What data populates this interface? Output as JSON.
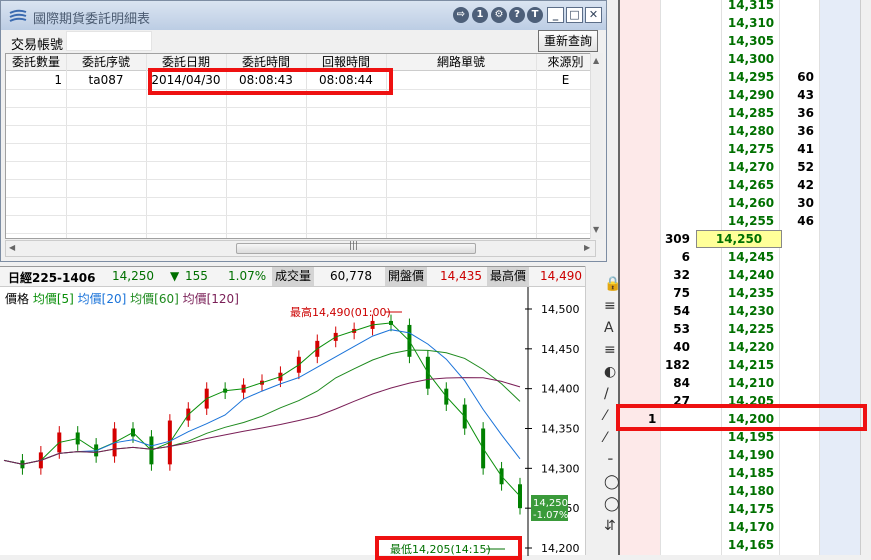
{
  "dialog": {
    "title": "國際期貨委託明細表",
    "title_buttons": [
      "⇨",
      "1",
      "⚙",
      "?",
      "T"
    ],
    "account_label": "交易帳號",
    "requery_label": "重新查詢",
    "columns": [
      "委託數量",
      "委託序號",
      "委託日期",
      "委託時間",
      "回報時間",
      "網路單號",
      "來源別"
    ],
    "rows": [
      [
        "1",
        "ta087",
        "2014/04/30",
        "08:08:43",
        "08:08:44",
        "",
        "E"
      ]
    ],
    "scroll_grip": "|||"
  },
  "chart": {
    "ticker": {
      "name": "日經225-1406",
      "last": "14,250",
      "arrow": "▼",
      "change": "155",
      "pct": "1.07%",
      "vol_label": "成交量",
      "vol": "60,778",
      "open_label": "開盤價",
      "open": "14,435",
      "high_label": "最高價",
      "high": "14,490"
    },
    "legend": {
      "price": "價格",
      "ma5": "均價[5]",
      "ma20": "均價[20]",
      "ma60": "均價[60]",
      "ma120": "均價[120]"
    },
    "colors": {
      "ma5": "#0a8f0a",
      "ma20": "#1a73d9",
      "ma60": "#1e8a1e",
      "ma120": "#7a1f57",
      "up": "#d40000",
      "down": "#008000"
    },
    "high_note": "最高14,490(01:00)",
    "low_note": "最低14,205(14:15)",
    "last_tag": "14,250",
    "last_tag_pct": "-1.07%",
    "y_ticks": [
      "14,500",
      "14,450",
      "14,400",
      "14,350",
      "14,300",
      "14,250",
      "14,200"
    ],
    "tick_levels": [
      14500,
      14450,
      14400,
      14350,
      14300,
      14250,
      14200
    ]
  },
  "chart_data": {
    "type": "line",
    "title": "日經225-1406",
    "ylim": [
      14200,
      14500
    ],
    "series": [
      {
        "name": "價格",
        "values": [
          14310,
          14300,
          14320,
          14345,
          14330,
          14315,
          14350,
          14340,
          14305,
          14360,
          14375,
          14400,
          14395,
          14405,
          14410,
          14420,
          14440,
          14460,
          14470,
          14475,
          14485,
          14480,
          14440,
          14400,
          14380,
          14350,
          14300,
          14280,
          14250
        ]
      }
    ]
  },
  "tools": {
    "items": [
      "🔒",
      "≡",
      "A",
      "≡",
      "◐",
      "/",
      "⁄",
      "⁄",
      "╶",
      "◯",
      "◯",
      "⇵"
    ]
  },
  "ladder": {
    "rows": [
      {
        "price": "14,315",
        "buy": "",
        "sell": ""
      },
      {
        "price": "14,310",
        "buy": "",
        "sell": ""
      },
      {
        "price": "14,305",
        "buy": "",
        "sell": ""
      },
      {
        "price": "14,300",
        "buy": "",
        "sell": ""
      },
      {
        "price": "14,295",
        "buy": "",
        "sell": "60"
      },
      {
        "price": "14,290",
        "buy": "",
        "sell": "43"
      },
      {
        "price": "14,285",
        "buy": "",
        "sell": "36"
      },
      {
        "price": "14,280",
        "buy": "",
        "sell": "36"
      },
      {
        "price": "14,275",
        "buy": "",
        "sell": "41"
      },
      {
        "price": "14,270",
        "buy": "",
        "sell": "52"
      },
      {
        "price": "14,265",
        "buy": "",
        "sell": "42"
      },
      {
        "price": "14,260",
        "buy": "",
        "sell": "30"
      },
      {
        "price": "14,255",
        "buy": "",
        "sell": "46"
      },
      {
        "price": "14,250",
        "buy": "309",
        "sell": ""
      },
      {
        "price": "14,245",
        "buy": "6",
        "sell": ""
      },
      {
        "price": "14,240",
        "buy": "32",
        "sell": ""
      },
      {
        "price": "14,235",
        "buy": "75",
        "sell": ""
      },
      {
        "price": "14,230",
        "buy": "54",
        "sell": ""
      },
      {
        "price": "14,225",
        "buy": "53",
        "sell": ""
      },
      {
        "price": "14,220",
        "buy": "40",
        "sell": ""
      },
      {
        "price": "14,215",
        "buy": "182",
        "sell": ""
      },
      {
        "price": "14,210",
        "buy": "84",
        "sell": ""
      },
      {
        "price": "14,205",
        "buy": "27",
        "sell": ""
      },
      {
        "price": "14,200",
        "buy": "",
        "sell": "",
        "order": "1"
      },
      {
        "price": "14,195",
        "buy": "",
        "sell": ""
      },
      {
        "price": "14,190",
        "buy": "",
        "sell": ""
      },
      {
        "price": "14,185",
        "buy": "",
        "sell": ""
      },
      {
        "price": "14,180",
        "buy": "",
        "sell": ""
      },
      {
        "price": "14,175",
        "buy": "",
        "sell": ""
      },
      {
        "price": "14,170",
        "buy": "",
        "sell": ""
      },
      {
        "price": "14,165",
        "buy": "",
        "sell": ""
      }
    ],
    "current_price": "14,250"
  }
}
